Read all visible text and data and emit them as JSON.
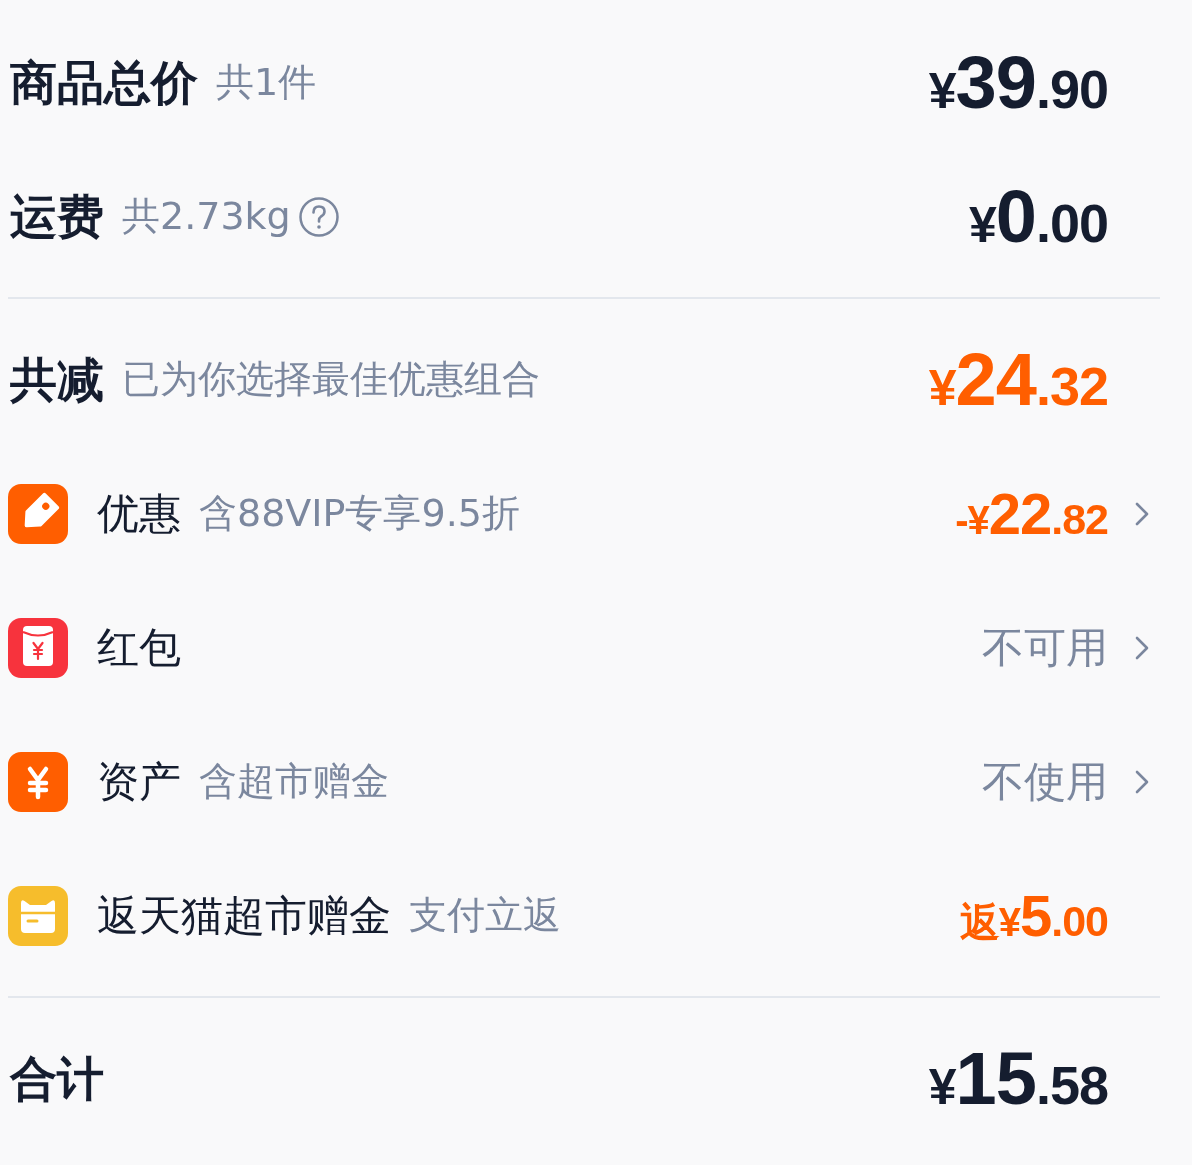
{
  "sections": [
    {
      "rows": [
        {
          "kind": "summary",
          "label": "商品总价",
          "note": "共1件",
          "help": false,
          "navigable": false,
          "amount": {
            "prefix": "¥",
            "integer": "39",
            "decimal": ".90",
            "highlighted": false
          }
        },
        {
          "kind": "summary",
          "label": "运费",
          "note": "共2.73kg",
          "help": true,
          "navigable": false,
          "amount": {
            "prefix": "¥",
            "integer": "0",
            "decimal": ".00",
            "highlighted": false
          }
        }
      ]
    },
    {
      "rows": [
        {
          "kind": "summary",
          "label": "共减",
          "note": "已为你选择最佳优惠组合",
          "help": false,
          "navigable": false,
          "amount": {
            "prefix": "¥",
            "integer": "24",
            "decimal": ".32",
            "highlighted": true
          }
        },
        {
          "kind": "discount",
          "label": "优惠",
          "note": "含88VIP专享9.5折",
          "help": false,
          "navigable": true,
          "amount": {
            "prefix": "-¥",
            "integer": "22",
            "decimal": ".82",
            "highlighted": true
          }
        },
        {
          "kind": "redpacket",
          "label": "红包",
          "help": false,
          "navigable": true,
          "status": "不可用"
        },
        {
          "kind": "asset",
          "label": "资产",
          "note": "含超市赠金",
          "help": false,
          "navigable": true,
          "status": "不使用"
        },
        {
          "kind": "rebate",
          "label": "返天猫超市赠金",
          "note": "支付立返",
          "help": false,
          "navigable": false,
          "amount": {
            "prefix": "返¥",
            "integer": "5",
            "decimal": ".00",
            "highlighted": true
          }
        }
      ]
    },
    {
      "rows": [
        {
          "kind": "summary",
          "label": "合计",
          "help": false,
          "navigable": false,
          "amount": {
            "prefix": "¥",
            "integer": "15",
            "decimal": ".58",
            "highlighted": false
          }
        }
      ]
    }
  ]
}
